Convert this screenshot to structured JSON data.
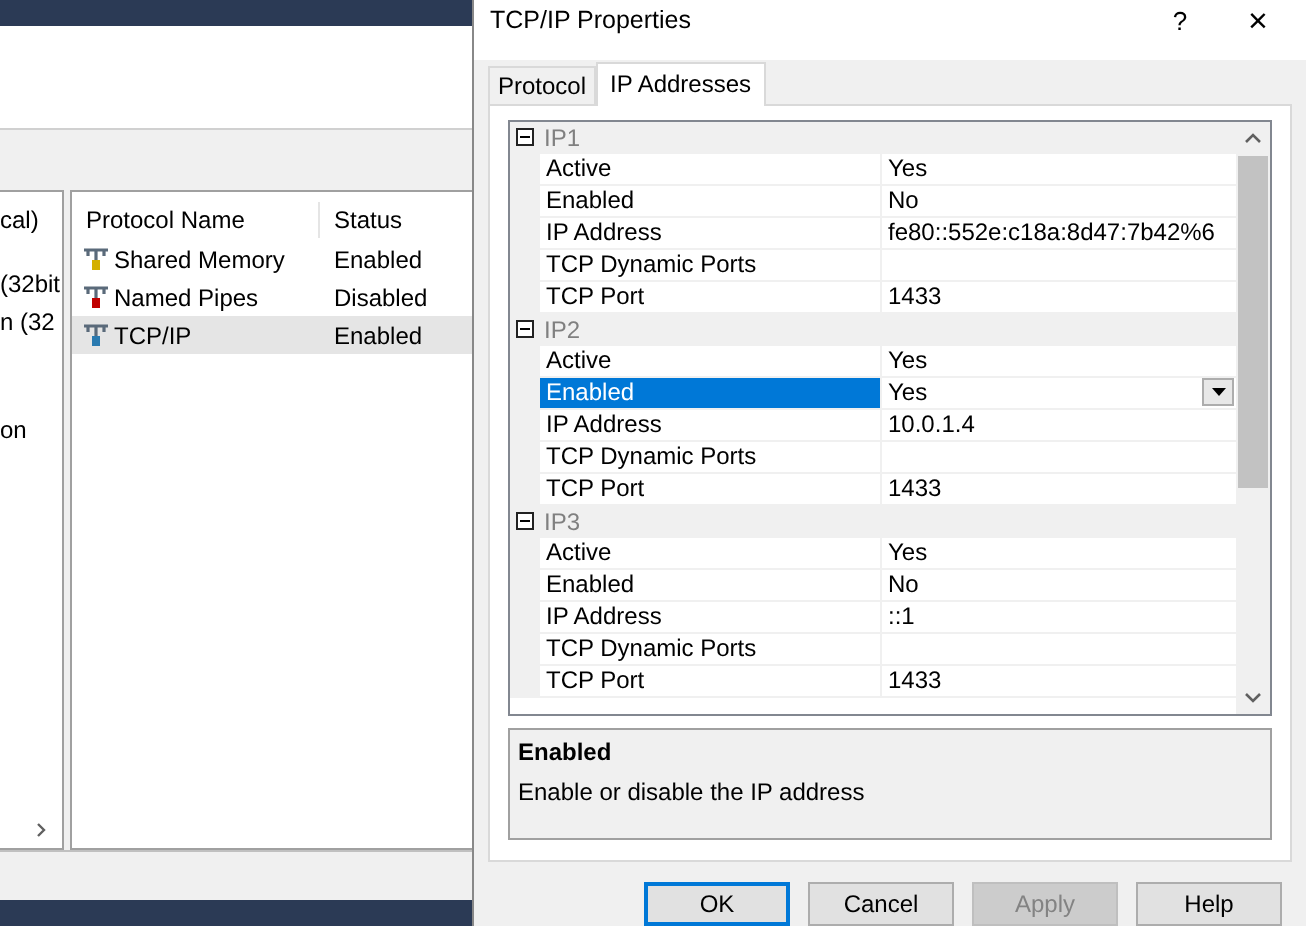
{
  "background_window": {
    "tree_fragments": [
      "cal)",
      "(32bit",
      "n (32",
      "on"
    ],
    "protocol_list": {
      "columns": [
        "Protocol Name",
        "Status"
      ],
      "rows": [
        {
          "name": "Shared Memory",
          "status": "Enabled",
          "color": "#d4b000",
          "selected": false
        },
        {
          "name": "Named Pipes",
          "status": "Disabled",
          "color": "#c00000",
          "selected": false
        },
        {
          "name": "TCP/IP",
          "status": "Enabled",
          "color": "#2a7ab0",
          "selected": true
        }
      ]
    }
  },
  "dialog": {
    "title": "TCP/IP Properties",
    "help": "?",
    "close": "×",
    "tabs": [
      {
        "label": "Protocol",
        "selected": false
      },
      {
        "label": "IP Addresses",
        "selected": true
      }
    ],
    "property_grid": {
      "groups": [
        {
          "name": "IP1",
          "expanded": true,
          "rows": [
            {
              "name": "Active",
              "value": "Yes",
              "selected": false
            },
            {
              "name": "Enabled",
              "value": "No",
              "selected": false
            },
            {
              "name": "IP Address",
              "value": "fe80::552e:c18a:8d47:7b42%6",
              "selected": false
            },
            {
              "name": "TCP Dynamic Ports",
              "value": "",
              "selected": false
            },
            {
              "name": "TCP Port",
              "value": "1433",
              "selected": false
            }
          ]
        },
        {
          "name": "IP2",
          "expanded": true,
          "rows": [
            {
              "name": "Active",
              "value": "Yes",
              "selected": false
            },
            {
              "name": "Enabled",
              "value": "Yes",
              "selected": true
            },
            {
              "name": "IP Address",
              "value": "10.0.1.4",
              "selected": false
            },
            {
              "name": "TCP Dynamic Ports",
              "value": "",
              "selected": false
            },
            {
              "name": "TCP Port",
              "value": "1433",
              "selected": false
            }
          ]
        },
        {
          "name": "IP3",
          "expanded": true,
          "rows": [
            {
              "name": "Active",
              "value": "Yes",
              "selected": false
            },
            {
              "name": "Enabled",
              "value": "No",
              "selected": false
            },
            {
              "name": "IP Address",
              "value": "::1",
              "selected": false
            },
            {
              "name": "TCP Dynamic Ports",
              "value": "",
              "selected": false
            },
            {
              "name": "TCP Port",
              "value": "1433",
              "selected": false
            }
          ]
        }
      ]
    },
    "description": {
      "title": "Enabled",
      "text": "Enable or disable the IP address"
    },
    "buttons": [
      {
        "label": "OK",
        "kind": "default"
      },
      {
        "label": "Cancel",
        "kind": "normal"
      },
      {
        "label": "Apply",
        "kind": "disabled"
      },
      {
        "label": "Help",
        "kind": "normal"
      }
    ]
  }
}
